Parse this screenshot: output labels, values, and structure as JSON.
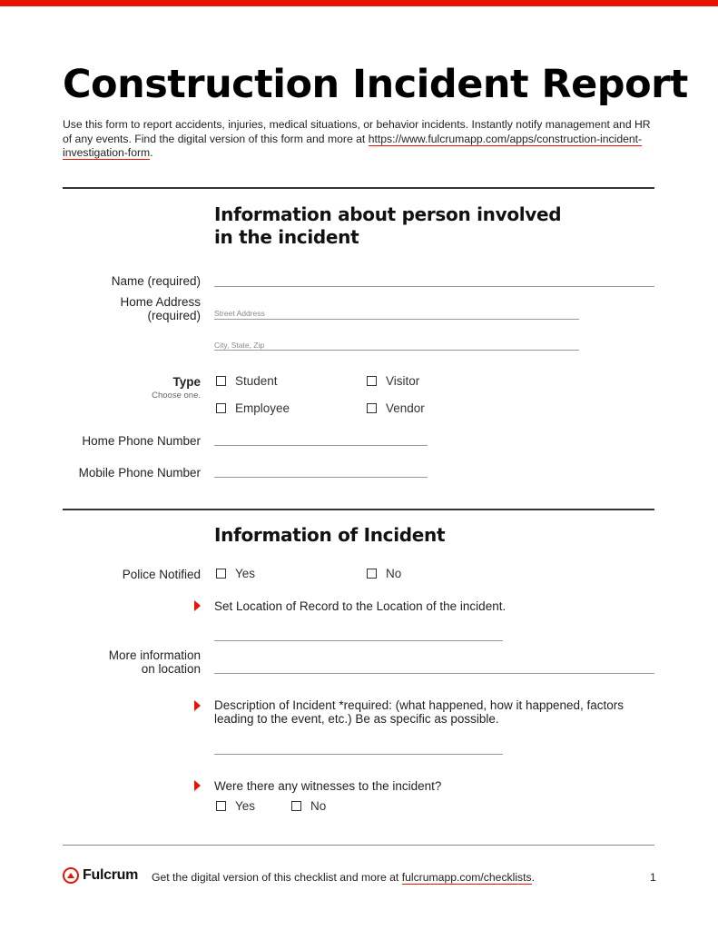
{
  "header": {
    "title": "Construction Incident Report",
    "intro_text": "Use this form to report accidents, injuries, medical situations, or behavior incidents. Instantly notify management and HR of any events. Find the digital version of this form and more at ",
    "intro_link": "https://www.fulcrumapp.com/apps/construction-incident-investigation-form",
    "intro_end": "."
  },
  "section_person": {
    "title_line1": "Information about person involved",
    "title_line2": "in the incident",
    "name_label": "Name (required)",
    "address_label_1": "Home Address",
    "address_label_2": "(required)",
    "street_hint": "Street Address",
    "city_hint": "City, State, Zip",
    "type_label": "Type",
    "type_sub": "Choose one.",
    "type_options": [
      "Student",
      "Visitor",
      "Employee",
      "Vendor"
    ],
    "home_phone_label": "Home Phone Number",
    "mobile_phone_label": "Mobile Phone Number"
  },
  "section_incident": {
    "title": "Information of Incident",
    "police_label": "Police Notified",
    "police_options": [
      "Yes",
      "No"
    ],
    "location_prompt": "Set Location of Record to the Location of the incident.",
    "more_info_label_1": "More information",
    "more_info_label_2": "on location",
    "description_prompt": "Description of Incident *required: (what happened, how it happened, factors leading to the event, etc.) Be as specific as possible.",
    "witness_prompt": "Were there any witnesses to the incident?",
    "witness_options": [
      "Yes",
      "No"
    ]
  },
  "footer": {
    "brand": "Fulcrum",
    "text": "Get the digital version of this checklist and more at ",
    "link": "fulcrumapp.com/checklists",
    "text_end": ".",
    "page_number": "1"
  },
  "colors": {
    "accent": "#e81400",
    "text": "#1a1a1a",
    "rule": "#333333"
  }
}
